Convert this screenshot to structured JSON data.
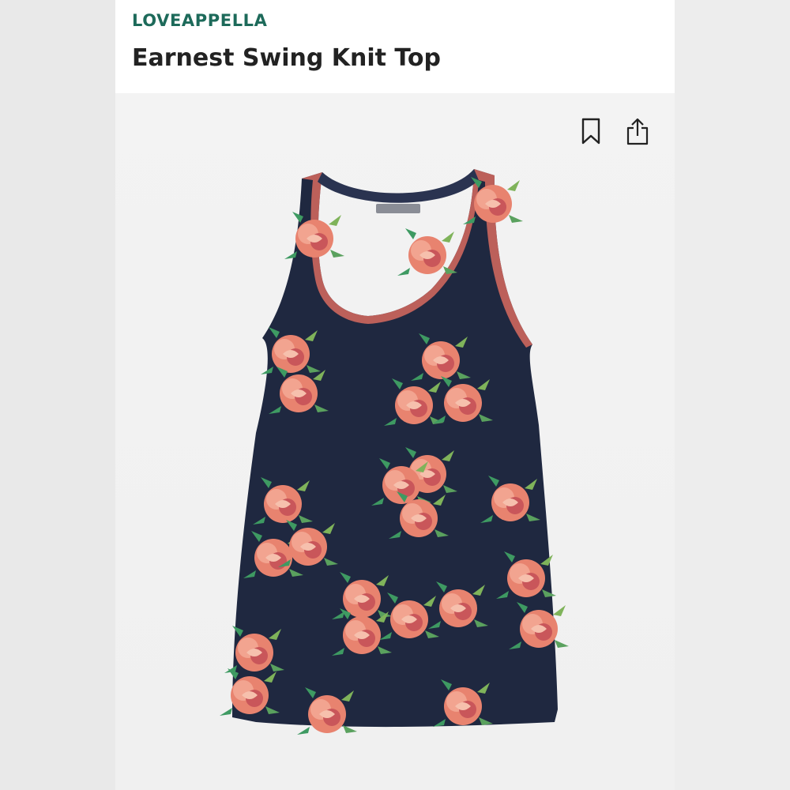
{
  "product": {
    "brand": "LOVEAPPELLA",
    "name": "Earnest Swing Knit Top",
    "image_label": "Loveappella",
    "image_alt": "Navy sleeveless swing knit tank top with coral and pink rose floral print"
  },
  "actions": {
    "bookmark_icon": "bookmark-icon",
    "share_icon": "share-icon"
  },
  "colors": {
    "brand": "#1d6a5a",
    "garment": "#1f2840",
    "rose": "#e8836f"
  }
}
